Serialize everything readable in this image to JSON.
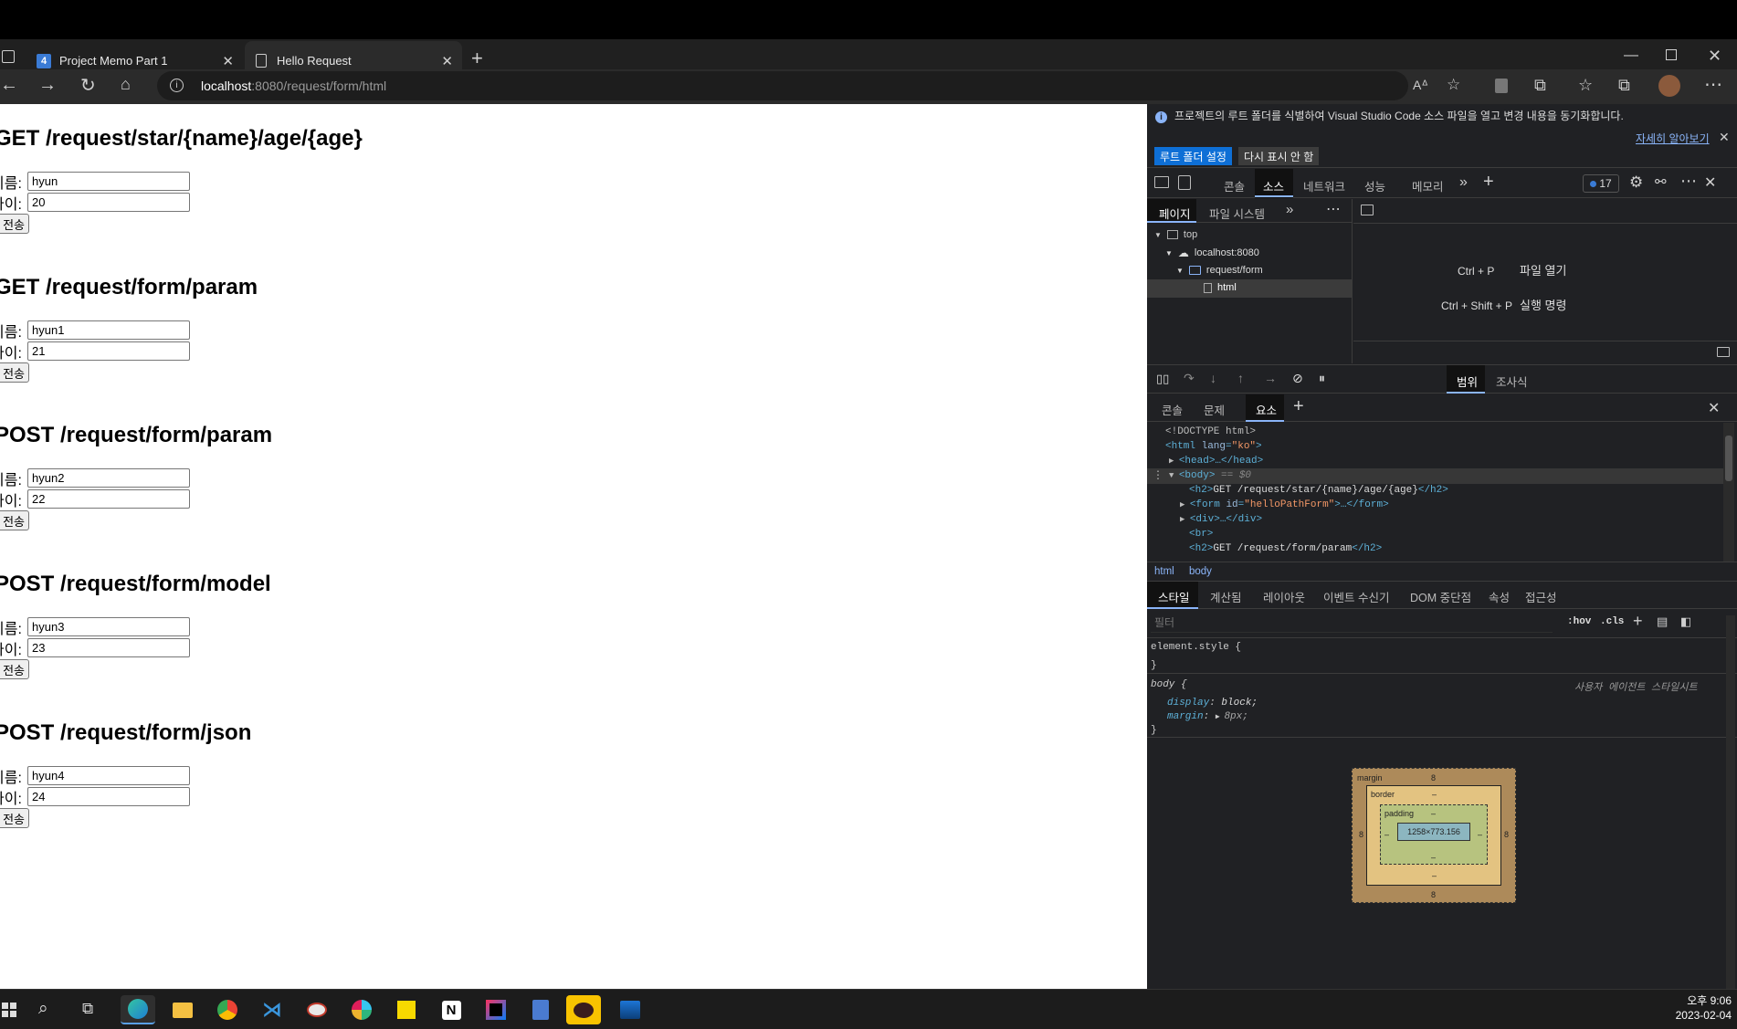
{
  "browser": {
    "tabs": [
      {
        "label": "Project Memo Part 1",
        "icon": "notion-style-4-icon"
      },
      {
        "label": "Hello Request",
        "icon": "document-icon"
      }
    ],
    "url_host": "localhost",
    "url_rest": ":8080/request/form/html"
  },
  "page": {
    "sections": [
      {
        "heading": "GET /request/star/{name}/age/{age}",
        "name_label": "이름:",
        "name_value": "hyun",
        "age_label": "나이:",
        "age_value": "20",
        "submit": "전송"
      },
      {
        "heading": "GET /request/form/param",
        "name_label": "이름:",
        "name_value": "hyun1",
        "age_label": "나이:",
        "age_value": "21",
        "submit": "전송"
      },
      {
        "heading": "POST /request/form/param",
        "name_label": "이름:",
        "name_value": "hyun2",
        "age_label": "나이:",
        "age_value": "22",
        "submit": "전송"
      },
      {
        "heading": "POST /request/form/model",
        "name_label": "이름:",
        "name_value": "hyun3",
        "age_label": "나이:",
        "age_value": "23",
        "submit": "전송"
      },
      {
        "heading": "POST /request/form/json",
        "name_label": "이름:",
        "name_value": "hyun4",
        "age_label": "나이:",
        "age_value": "24",
        "submit": "전송"
      }
    ]
  },
  "devtools": {
    "infobar": {
      "text": "프로젝트의 루트 폴더를 식별하여 Visual Studio Code 소스 파일을 열고 변경 내용을 동기화합니다.",
      "learn_more": "자세히 알아보기",
      "set_root_btn": "루트 폴더 설정",
      "dont_show_btn": "다시 표시 안 함"
    },
    "main_tabs": [
      "콘솔",
      "소스",
      "네트워크",
      "성능",
      "메모리"
    ],
    "selected_main_tab": "소스",
    "issues_count": "17",
    "nav_tabs": [
      "페이지",
      "파일 시스템"
    ],
    "tree": [
      "top",
      "localhost:8080",
      "request/form",
      "html"
    ],
    "shortcuts": [
      {
        "keys": "Ctrl + P",
        "action": "파일 열기"
      },
      {
        "keys": "Ctrl + Shift + P",
        "action": "실행 명령"
      }
    ],
    "scope_tabs": [
      "범위",
      "조사식"
    ],
    "drawer_tabs": [
      "콘솔",
      "문제",
      "요소"
    ],
    "dom_lines": {
      "l1": "<!DOCTYPE html>",
      "l2_tag": "<html ",
      "l2_attr": "lang",
      "l2_val": "\"ko\"",
      "l2_end": ">",
      "l3": "<head>…</head>",
      "l4": "<body>",
      "l4_eq": " == $0",
      "l5_open": "<h2>",
      "l5_text": "GET /request/star/{name}/age/{age}",
      "l5_close": "</h2>",
      "l6_open": "<form ",
      "l6_attr": "id",
      "l6_val": "\"helloPathForm\"",
      "l6_close": ">…</form>",
      "l7": "<div>…</div>",
      "l8": "<br>",
      "l9_open": "<h2>",
      "l9_text": "GET /request/form/param",
      "l9_close": "</h2>"
    },
    "breadcrumbs": [
      "html",
      "body"
    ],
    "style_tabs": [
      "스타일",
      "계산됨",
      "레이아웃",
      "이벤트 수신기",
      "DOM 중단점",
      "속성",
      "접근성"
    ],
    "filter_placeholder": "필터",
    "hov": ":hov",
    "cls": ".cls",
    "element_style": "element.style {",
    "close_brace": "}",
    "body_rule": "body {",
    "ua_label": "사용자 에이전트 스타일시트",
    "decl1_prop": "display",
    "decl1_val": "block;",
    "decl2_prop": "margin",
    "decl2_val": "8px;",
    "box_model": {
      "margin_label": "margin",
      "margin_val": "8",
      "border_label": "border",
      "border_val": "–",
      "padding_label": "padding",
      "padding_val": "–",
      "content": "1258×773.156",
      "side_margin": "8",
      "dash": "–"
    }
  },
  "taskbar": {
    "time": "오후 9:06",
    "date": "2023-02-04"
  }
}
